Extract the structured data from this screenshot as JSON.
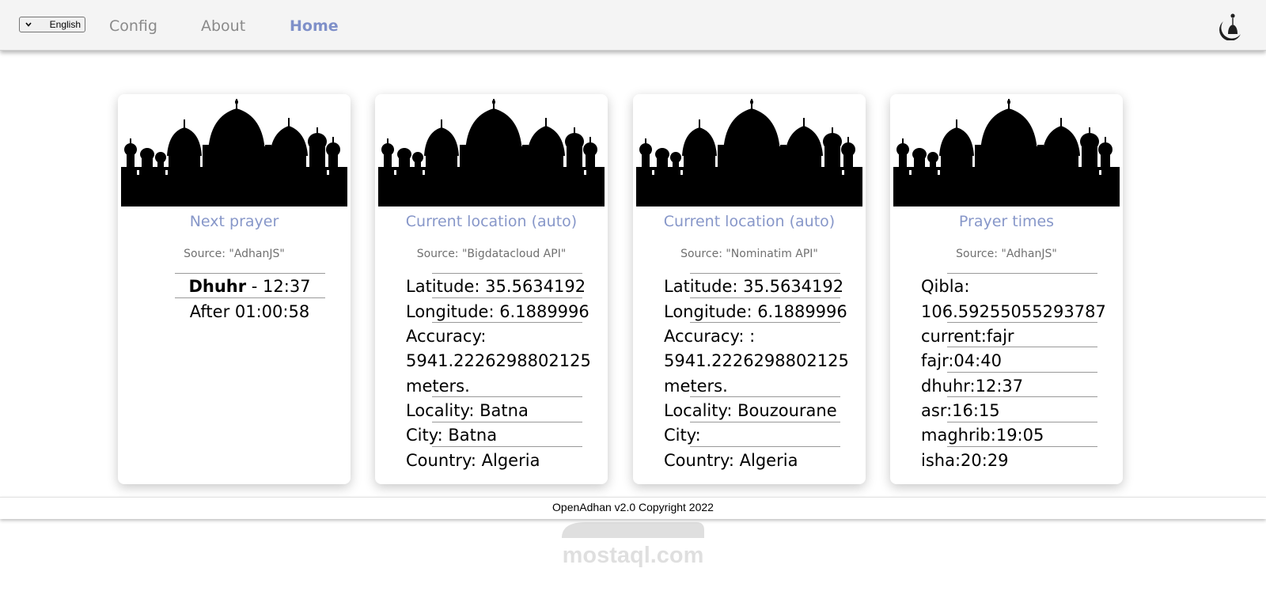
{
  "header": {
    "language": {
      "selected": "English"
    },
    "nav": [
      {
        "id": "config",
        "label": "Config",
        "active": false
      },
      {
        "id": "about",
        "label": "About",
        "active": false
      },
      {
        "id": "home",
        "label": "Home",
        "active": true
      }
    ],
    "logo_icon": "moon-mosque-logo-icon"
  },
  "cards": [
    {
      "title": "Next prayer",
      "source": "Source: \"AdhanJS\"",
      "prayer_name": "Dhuhr",
      "prayer_time": " - 12:37",
      "countdown": "After 01:00:58"
    },
    {
      "title": "Current location (auto)",
      "source": "Source: \"Bigdatacloud API\"",
      "lines": [
        "Latitude: 35.5634192",
        "Longitude: 6.1889996",
        "Accuracy:",
        "5941.2226298802125",
        "meters.",
        "Locality: Batna",
        "City: Batna",
        "Country: Algeria"
      ]
    },
    {
      "title": "Current location (auto)",
      "source": "Source: \"Nominatim API\"",
      "lines": [
        "Latitude: 35.5634192",
        "Longitude: 6.1889996",
        "Accuracy: :",
        "5941.2226298802125",
        "meters.",
        "Locality: Bouzourane",
        "City:",
        "Country: Algeria"
      ]
    },
    {
      "title": "Prayer times",
      "source": "Source: \"AdhanJS\"",
      "lines": [
        "Qibla:",
        "106.59255055293787",
        "current:fajr",
        "fajr:04:40",
        "dhuhr:12:37",
        "asr:16:15",
        "maghrib:19:05",
        "isha:20:29"
      ]
    }
  ],
  "footer": {
    "text": "OpenAdhan v2.0 Copyright 2022"
  },
  "watermark": {
    "text": "mostaql.com"
  },
  "colors": {
    "accent": "#7f90c9",
    "title": "#8797c9",
    "nav_inactive": "#8a8a8a",
    "topbar_bg": "#f4f4f4"
  }
}
